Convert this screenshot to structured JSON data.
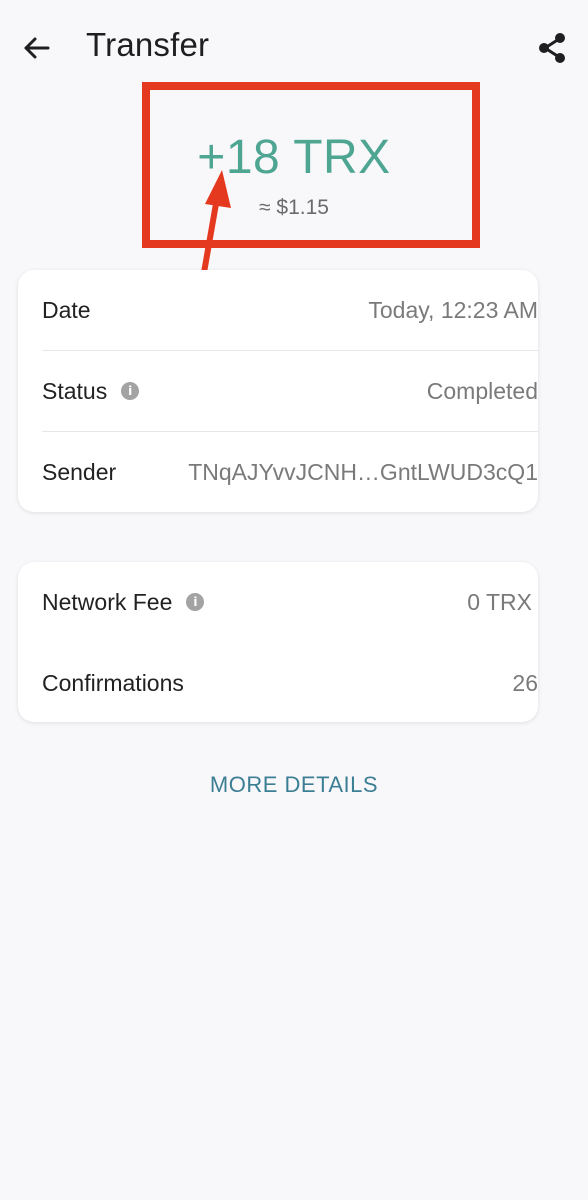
{
  "header": {
    "title": "Transfer",
    "back_icon": "arrow-left-icon",
    "share_icon": "share-icon"
  },
  "amount": {
    "value": "+18 TRX",
    "fiat": "≈ $1.15",
    "color": "#4ea592"
  },
  "details": {
    "date_label": "Date",
    "date_value": "Today, 12:23 AM",
    "status_label": "Status",
    "status_value": "Completed",
    "sender_label": "Sender",
    "sender_value": "TNqAJYvvJCNH…GntLWUD3cQ1"
  },
  "fees": {
    "network_fee_label": "Network Fee",
    "network_fee_value": "0 TRX",
    "confirmations_label": "Confirmations",
    "confirmations_value": "26"
  },
  "more_details_label": "MORE DETAILS",
  "colors": {
    "accent_green": "#4ea592",
    "link_blue": "#3c7f94",
    "annotation_red": "#e5391f",
    "background": "#f8f7fa"
  }
}
